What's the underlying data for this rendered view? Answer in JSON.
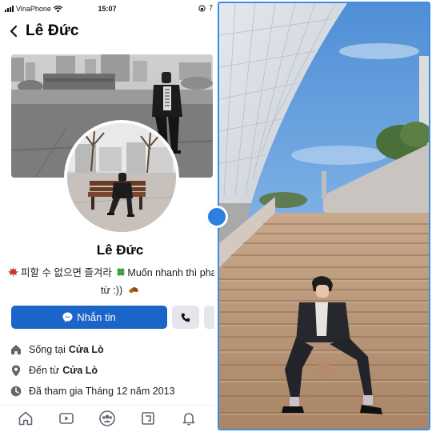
{
  "status_bar": {
    "carrier": "VinaPhone",
    "time": "15:07",
    "battery_partial": "7"
  },
  "header": {
    "title": "Lê Đức"
  },
  "profile": {
    "name": "Lê Đức",
    "bio_line1": "피할 수 없으면 즐겨라",
    "bio_line1_rest": "Muốn nhanh thì pha",
    "bio_line2": "từ :))"
  },
  "actions": {
    "message_label": "Nhắn tin"
  },
  "info": [
    {
      "label": "Sống tại",
      "value": "Cửa Lò",
      "icon": "home-icon"
    },
    {
      "label": "Đến từ",
      "value": "Cửa Lò",
      "icon": "location-pin-icon"
    },
    {
      "label": "Đã tham gia Tháng 12 năm 2013",
      "value": "",
      "icon": "clock-icon"
    }
  ],
  "bottom_nav": [
    "home-icon",
    "watch-icon",
    "groups-icon",
    "pages-icon",
    "notifications-icon"
  ],
  "colors": {
    "brand_blue": "#1b65c9",
    "button_gray": "#e4e6eb",
    "handle_blue": "#2d7fe0",
    "frame_blue": "#3a8ee6"
  }
}
